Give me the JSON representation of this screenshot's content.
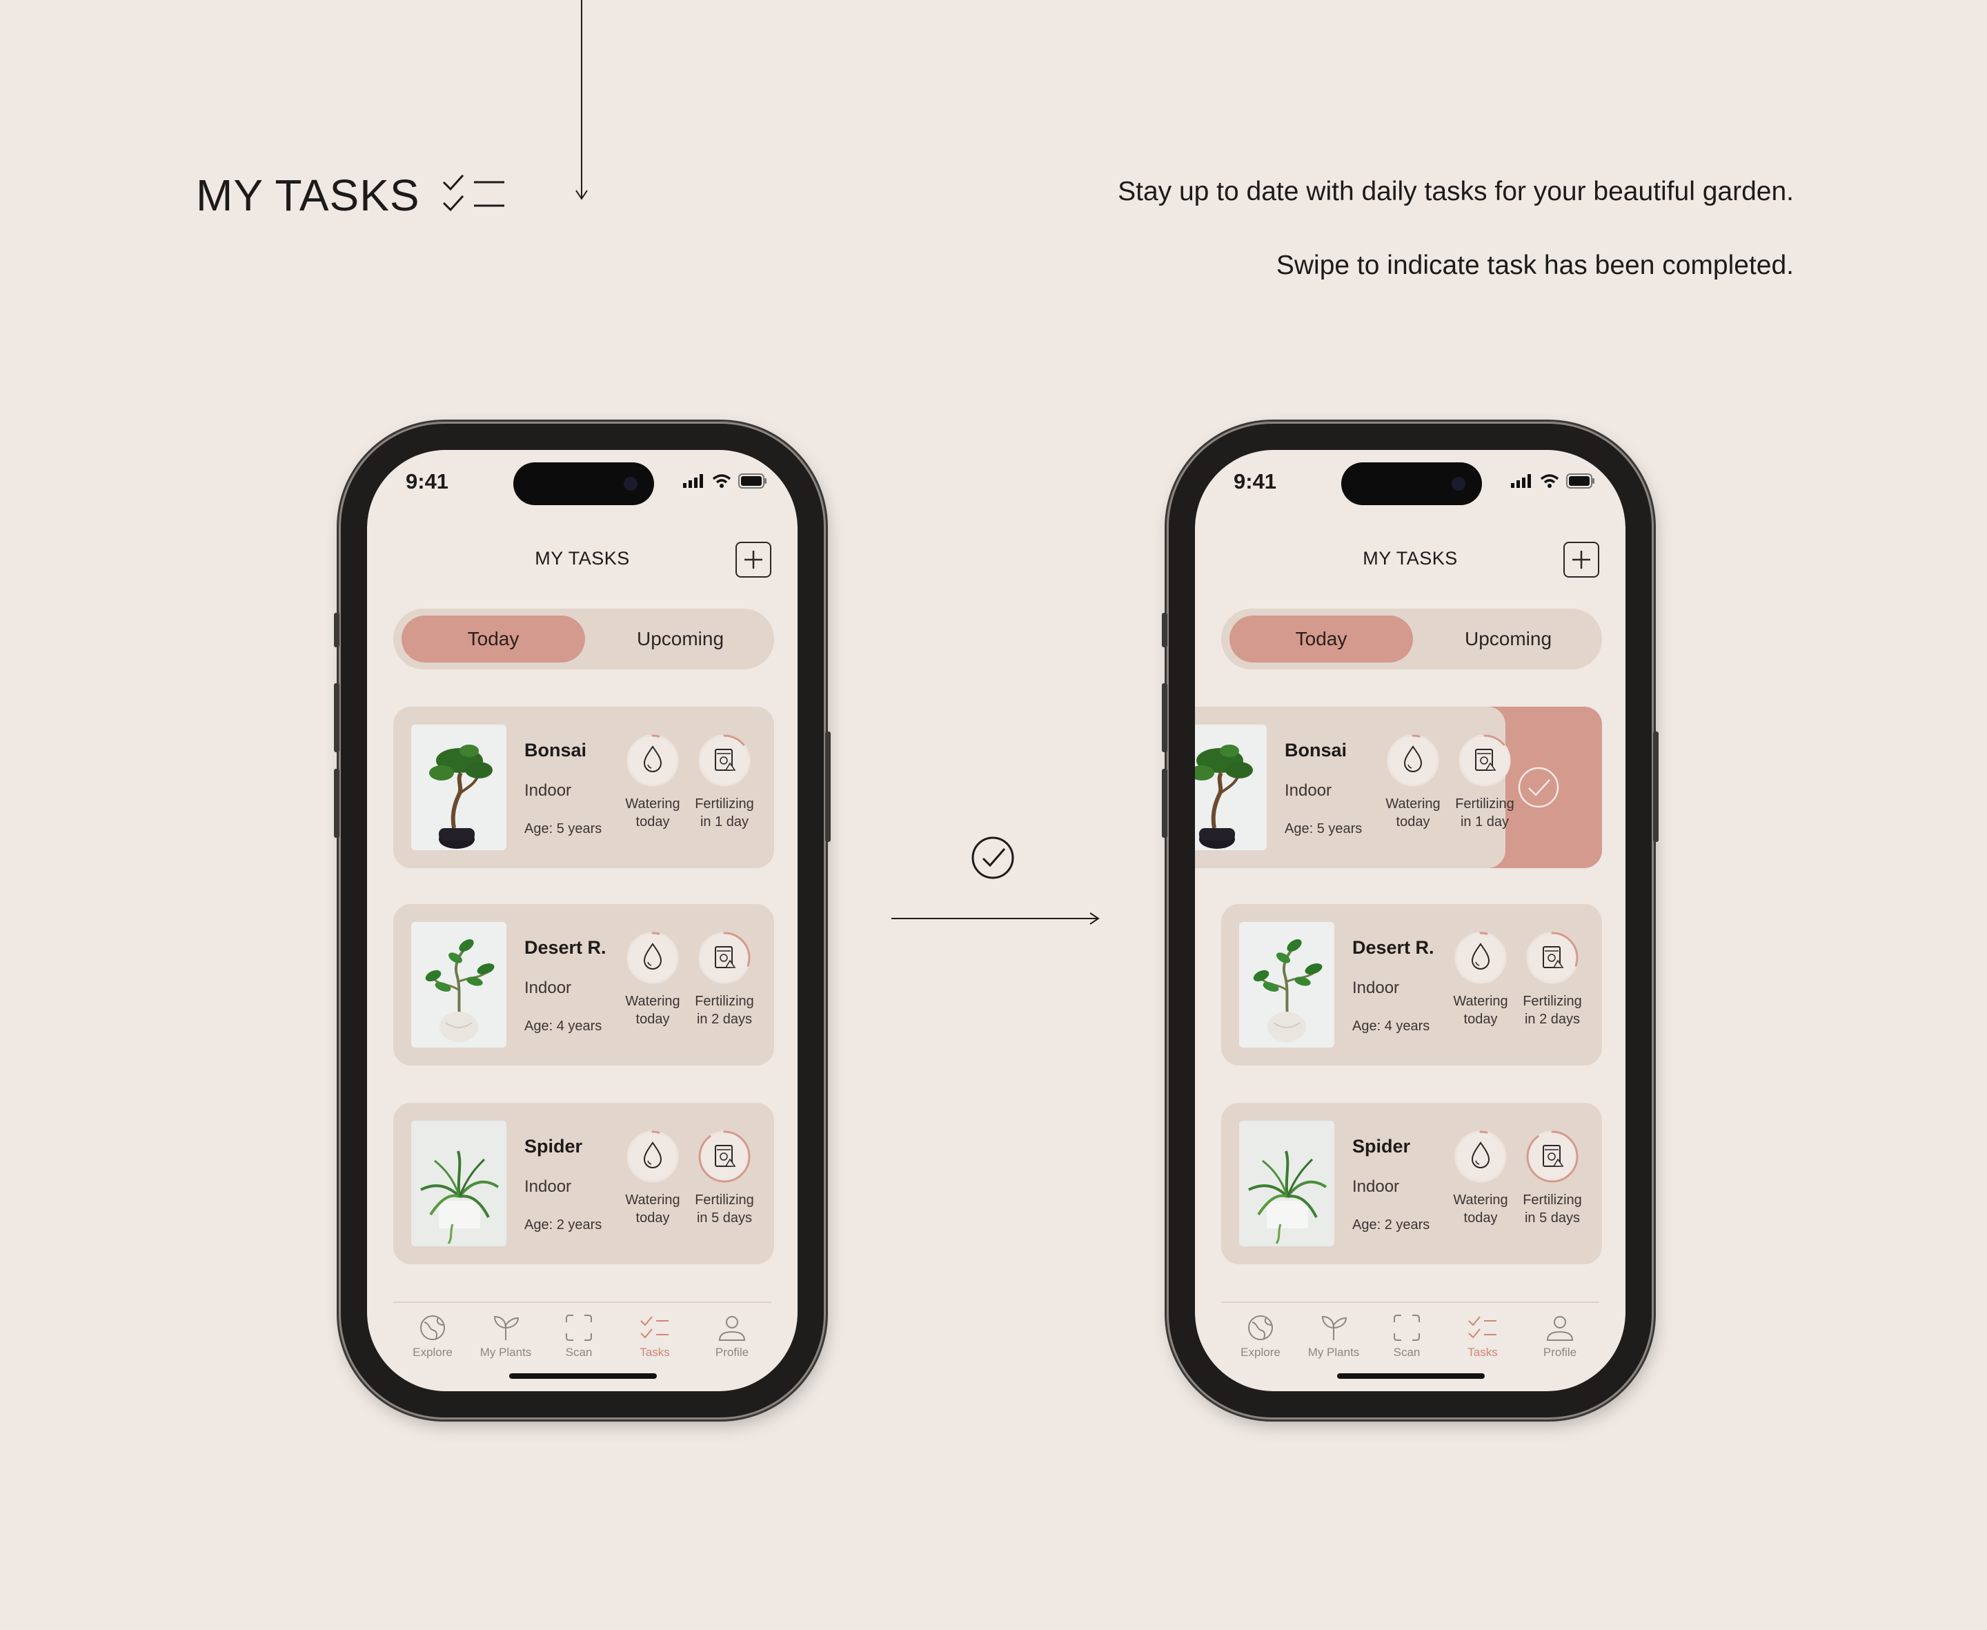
{
  "page": {
    "title": "MY TASKS",
    "description_1": "Stay up to date with daily tasks for your beautiful garden.",
    "description_2": "Swipe to indicate task has been completed.",
    "accent_color": "#d49a8d",
    "background_color": "#efe8e3"
  },
  "phones": [
    {
      "status": {
        "time": "9:41"
      },
      "header": {
        "title": "MY TASKS",
        "add_icon": "plus-icon"
      },
      "segment": {
        "today": "Today",
        "upcoming": "Upcoming",
        "selected": "Today"
      },
      "cards": [
        {
          "name": "Bonsai",
          "location": "Indoor",
          "age": "Age: 5 years",
          "watering": {
            "line1": "Watering",
            "line2": "today",
            "progress": 0.04
          },
          "fertilizing": {
            "line1": "Fertilizing",
            "line2": "in 1 day",
            "progress": 0.14
          }
        },
        {
          "name": "Desert R.",
          "location": "Indoor",
          "age": "Age: 4 years",
          "watering": {
            "line1": "Watering",
            "line2": "today",
            "progress": 0.04
          },
          "fertilizing": {
            "line1": "Fertilizing",
            "line2": "in 2 days",
            "progress": 0.3
          }
        },
        {
          "name": "Spider",
          "location": "Indoor",
          "age": "Age: 2 years",
          "watering": {
            "line1": "Watering",
            "line2": "today",
            "progress": 0.04
          },
          "fertilizing": {
            "line1": "Fertilizing",
            "line2": "in 5 days",
            "progress": 0.9
          }
        }
      ],
      "tabs": [
        {
          "label": "Explore",
          "icon": "globe-icon"
        },
        {
          "label": "My Plants",
          "icon": "sprout-icon"
        },
        {
          "label": "Scan",
          "icon": "scan-icon"
        },
        {
          "label": "Tasks",
          "icon": "tasks-icon",
          "active": true
        },
        {
          "label": "Profile",
          "icon": "profile-icon"
        }
      ]
    },
    {
      "status": {
        "time": "9:41"
      },
      "header": {
        "title": "MY TASKS",
        "add_icon": "plus-icon"
      },
      "segment": {
        "today": "Today",
        "upcoming": "Upcoming",
        "selected": "Today"
      },
      "cards": [
        {
          "name": "Bonsai",
          "location": "Indoor",
          "age": "Age: 5 years",
          "swiped": true,
          "watering": {
            "line1": "Watering",
            "line2": "today",
            "progress": 0.04
          },
          "fertilizing": {
            "line1": "Fertilizing",
            "line2": "in 1 day",
            "progress": 0.14
          }
        },
        {
          "name": "Desert R.",
          "location": "Indoor",
          "age": "Age: 4 years",
          "watering": {
            "line1": "Watering",
            "line2": "today",
            "progress": 0.04
          },
          "fertilizing": {
            "line1": "Fertilizing",
            "line2": "in 2 days",
            "progress": 0.3
          }
        },
        {
          "name": "Spider",
          "location": "Indoor",
          "age": "Age: 2 years",
          "watering": {
            "line1": "Watering",
            "line2": "today",
            "progress": 0.04
          },
          "fertilizing": {
            "line1": "Fertilizing",
            "line2": "in 5 days",
            "progress": 0.9
          }
        }
      ],
      "tabs": [
        {
          "label": "Explore",
          "icon": "globe-icon"
        },
        {
          "label": "My Plants",
          "icon": "sprout-icon"
        },
        {
          "label": "Scan",
          "icon": "scan-icon"
        },
        {
          "label": "Tasks",
          "icon": "tasks-icon",
          "active": true
        },
        {
          "label": "Profile",
          "icon": "profile-icon"
        }
      ]
    }
  ]
}
